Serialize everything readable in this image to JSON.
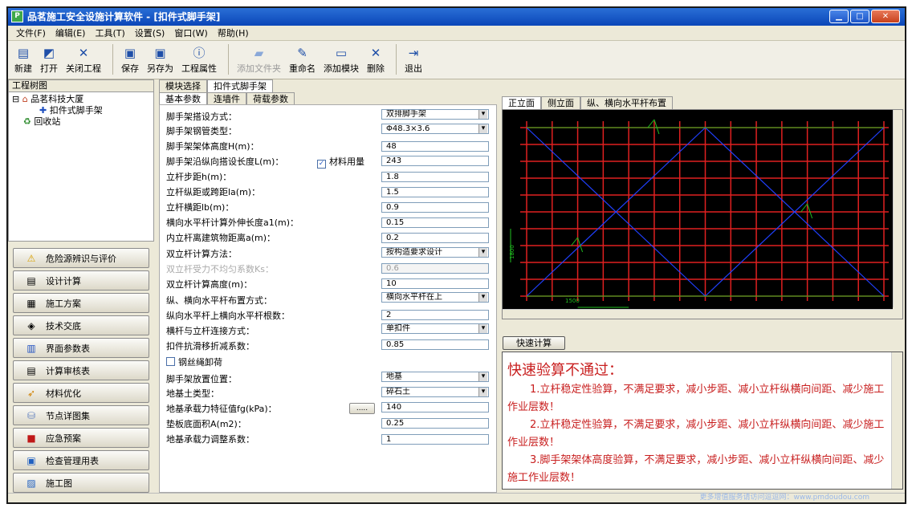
{
  "window": {
    "title": "品茗施工安全设施计算软件 - [扣件式脚手架]",
    "app_icon": "P",
    "min": "▁",
    "max": "□",
    "close": "✕"
  },
  "menu": [
    "文件(F)",
    "编辑(E)",
    "工具(T)",
    "设置(S)",
    "窗口(W)",
    "帮助(H)"
  ],
  "toolbar": {
    "new": "新建",
    "open": "打开",
    "close_project": "关闭工程",
    "save": "保存",
    "save_as": "另存为",
    "project_props": "工程属性",
    "add_folder": "添加文件夹",
    "rename": "重命名",
    "add_module": "添加模块",
    "delete": "删除",
    "exit": "退出"
  },
  "left": {
    "tree_header": "工程树图",
    "tree": {
      "root": "品茗科技大厦",
      "child": "扣件式脚手架",
      "recycle": "回收站"
    },
    "nav": [
      "危险源辨识与评价",
      "设计计算",
      "施工方案",
      "技术交底",
      "界面参数表",
      "计算审核表",
      "材料优化",
      "节点详图集",
      "应急预案",
      "检查管理用表",
      "施工图"
    ]
  },
  "mid": {
    "tabs": [
      "模块选择",
      "扣件式脚手架"
    ],
    "subtabs": [
      "基本参数",
      "连墙件",
      "荷载参数"
    ],
    "material_checkbox": "材料用量",
    "wire_rope_checkbox": "钢丝绳卸荷",
    "params": [
      {
        "label": "脚手架搭设方式：",
        "value": "双排脚手架"
      },
      {
        "label": "脚手架钢管类型：",
        "value": "Φ48.3×3.6"
      },
      {
        "label": "脚手架架体高度H(m)：",
        "value": "48"
      },
      {
        "label": "脚手架沿纵向搭设长度L(m)：",
        "value": "243"
      },
      {
        "label": "立杆步距h(m)：",
        "value": "1.8"
      },
      {
        "label": "立杆纵距或跨距la(m)：",
        "value": "1.5"
      },
      {
        "label": "立杆横距lb(m)：",
        "value": "0.9"
      },
      {
        "label": "横向水平杆计算外伸长度a1(m)：",
        "value": "0.15"
      },
      {
        "label": "内立杆离建筑物距离a(m)：",
        "value": "0.2"
      },
      {
        "label": "双立杆计算方法：",
        "value": "按构造要求设计"
      },
      {
        "label": "双立杆受力不均匀系数Ks：",
        "value": "0.6"
      },
      {
        "label": "双立杆计算高度(m)：",
        "value": "10"
      },
      {
        "label": "纵、横向水平杆布置方式：",
        "value": "横向水平杆在上"
      },
      {
        "label": "纵向水平杆上横向水平杆根数：",
        "value": "2"
      },
      {
        "label": "横杆与立杆连接方式：",
        "value": "单扣件"
      },
      {
        "label": "扣件抗滑移折减系数：",
        "value": "0.85"
      },
      {
        "label": "脚手架放置位置：",
        "value": "地基"
      },
      {
        "label": "地基土类型：",
        "value": "碎石土"
      },
      {
        "label": "地基承载力特征值fg(kPa)：",
        "value": "140"
      },
      {
        "label": "垫板底面积A(m2)：",
        "value": "0.25"
      },
      {
        "label": "地基承载力调整系数：",
        "value": "1"
      }
    ],
    "browse_btn": "....."
  },
  "right": {
    "tabs": [
      "正立面",
      "侧立面",
      "纵、横向水平杆布置"
    ],
    "dim_v": "1800",
    "dim_h": "1500",
    "quick_calc": "快速计算",
    "result_title": "快速验算不通过：",
    "results": [
      "1.立杆稳定性验算，不满足要求，减小步距、减小立杆纵横向间距、减少施工作业层数！",
      "2.立杆稳定性验算，不满足要求，减小步距、减小立杆纵横向间距、减少施工作业层数！",
      "3.脚手架架体高度验算，不满足要求，减小步距、减小立杆纵横向间距、减少施工作业层数！"
    ]
  },
  "status": {
    "text": "更多增值服务请访问逗逗网：www.pmdoudou.com"
  },
  "colors": {
    "pole": "#e02020",
    "brace": "#2040ff",
    "wall_tie": "#20c020",
    "result_text": "#c81e1e"
  }
}
